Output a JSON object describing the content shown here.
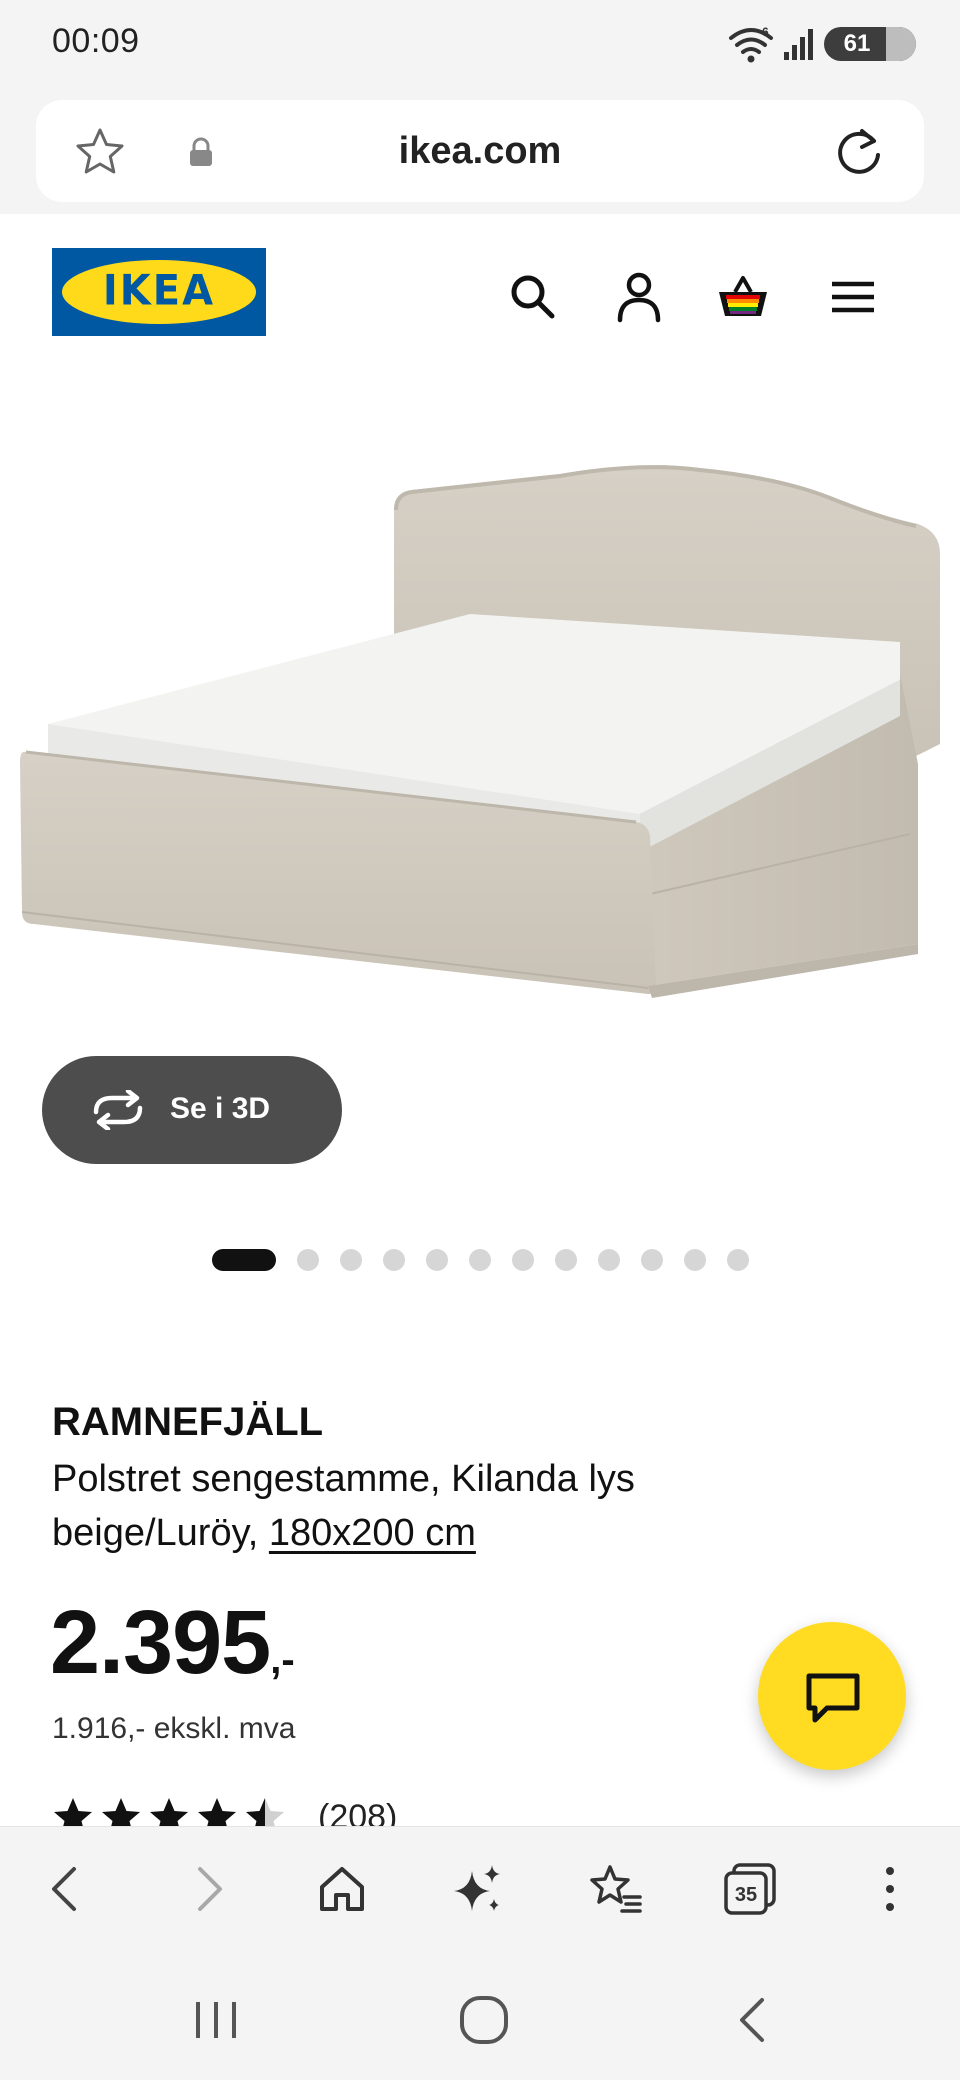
{
  "status_bar": {
    "time": "00:09",
    "wifi_badge": "6",
    "battery": "61",
    "icons": [
      "wifi-icon",
      "signal-icon",
      "battery-icon"
    ]
  },
  "browser": {
    "url": "ikea.com",
    "icons": [
      "star-icon",
      "lock-icon",
      "reload-icon"
    ]
  },
  "site_header": {
    "logo_text": "IKEA",
    "brand_colors": {
      "blue": "#0058a3",
      "yellow": "#ffda1a"
    },
    "icons": [
      "search-icon",
      "user-icon",
      "cart-icon",
      "menu-icon"
    ]
  },
  "gallery": {
    "view_3d_label": "Se i 3D",
    "dot_count": 12,
    "active_index": 0
  },
  "product": {
    "name": "RAMNEFJÄLL",
    "description": "Polstret sengestamme, Kilanda lys beige/Luröy,",
    "size": "180x200 cm",
    "price_main": "2.395",
    "price_suffix": ",-",
    "price_ex_vat": "1.916,- ekskl. mva",
    "rating_value": 4.5,
    "rating_count": "(208)"
  },
  "chat": {
    "icon": "chat-icon",
    "accent": "#ffdb22"
  },
  "browser_toolbar": {
    "tabs_count": "35",
    "icons": [
      "back-icon",
      "forward-icon",
      "home-icon",
      "sparkle-icon",
      "bookmarks-icon",
      "tabs-icon",
      "more-icon"
    ]
  },
  "system_nav": {
    "icons": [
      "recent-apps-icon",
      "home-circle-icon",
      "nav-back-icon"
    ]
  }
}
